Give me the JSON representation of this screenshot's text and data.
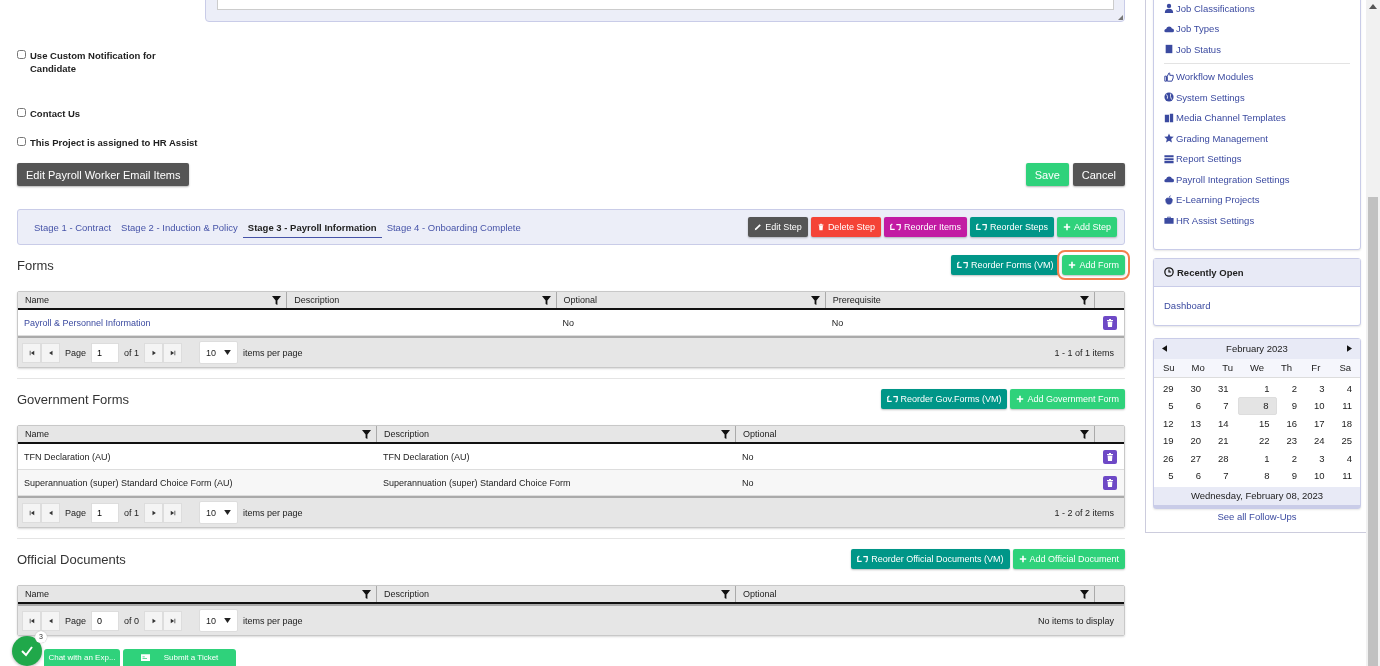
{
  "options": [
    {
      "label": "Use Custom Notification for Candidate",
      "checked": false
    },
    {
      "label": "Contact Us",
      "checked": false
    },
    {
      "label": "This Project is assigned to HR Assist",
      "checked": false
    }
  ],
  "edit_button": "Edit Payroll Worker Email Items",
  "actions": [
    {
      "label": "Save",
      "kind": "save"
    },
    {
      "label": "Cancel",
      "kind": "cancel"
    }
  ],
  "stage_tabs": [
    {
      "label": "Stage 1 - Contract",
      "selected": false
    },
    {
      "label": "Stage 2 - Induction & Policy",
      "selected": false
    },
    {
      "label": "Stage 3 - Payroll Information",
      "selected": true
    },
    {
      "label": "Stage 4 - Onboarding Complete",
      "selected": false
    }
  ],
  "step_buttons": [
    {
      "label": "Edit Step",
      "kind": "edit"
    },
    {
      "label": "Delete Step",
      "kind": "delete"
    },
    {
      "label": "Reorder Items",
      "kind": "reorder_items"
    },
    {
      "label": "Reorder Steps",
      "kind": "reorder"
    },
    {
      "label": "Add Step",
      "kind": "add"
    }
  ],
  "sections": [
    {
      "title": "Forms",
      "buttons": [
        {
          "label": "Reorder Forms (VM)",
          "kind": "reorder",
          "focused": false
        },
        {
          "label": "Add Form",
          "kind": "add",
          "focused": true
        }
      ],
      "table": {
        "columns": [
          "Name",
          "Description",
          "Optional",
          "Prerequisite"
        ],
        "rows": [
          {
            "link": true,
            "cells": [
              "Payroll & Personnel Information",
              null,
              "No",
              "No"
            ]
          }
        ],
        "pager": {
          "page_label": "Page",
          "page": "1",
          "of": "of 1",
          "page_size": "10",
          "per_page": "items per page",
          "info": "1 - 1 of 1 items"
        }
      }
    },
    {
      "title": "Government Forms",
      "buttons": [
        {
          "label": "Reorder Gov.Forms (VM)",
          "kind": "reorder",
          "focused": false
        },
        {
          "label": "Add Government Form",
          "kind": "add",
          "focused": false
        }
      ],
      "table": {
        "columns": [
          "Name",
          "Description",
          "Optional"
        ],
        "rows": [
          {
            "link": false,
            "cells": [
              "TFN Declaration (AU)",
              "TFN Declaration (AU)",
              "No"
            ]
          },
          {
            "link": false,
            "cells": [
              "Superannuation (super) Standard Choice Form (AU)",
              "Superannuation (super) Standard Choice Form",
              "No"
            ]
          }
        ],
        "pager": {
          "page_label": "Page",
          "page": "1",
          "of": "of 1",
          "page_size": "10",
          "per_page": "items per page",
          "info": "1 - 2 of 2 items"
        }
      }
    },
    {
      "title": "Official Documents",
      "buttons": [
        {
          "label": "Reorder Official Documents (VM)",
          "kind": "reorder",
          "focused": false
        },
        {
          "label": "Add Official Document",
          "kind": "add",
          "focused": false
        }
      ],
      "table": {
        "columns": [
          "Name",
          "Description",
          "Optional"
        ],
        "pager": {
          "page_label": "Page",
          "page": "0",
          "of": "of 0",
          "page_size": "10",
          "per_page": "items per page",
          "info": "No items to display"
        }
      }
    }
  ],
  "menu": [
    [
      {
        "label": "Job Classifications",
        "kind": "person"
      },
      {
        "label": "Job Types",
        "kind": "cloud"
      },
      {
        "label": "Job Status",
        "kind": "book"
      }
    ],
    [
      {
        "label": "Workflow Modules",
        "kind": "thumb"
      },
      {
        "label": "System Settings",
        "kind": "globe"
      },
      {
        "label": "Media Channel Templates",
        "kind": "files"
      },
      {
        "label": "Grading Management",
        "kind": "star"
      },
      {
        "label": "Report Settings",
        "kind": "report"
      },
      {
        "label": "Payroll Integration Settings",
        "kind": "cloud"
      },
      {
        "label": "E-Learning Projects",
        "kind": "apple"
      },
      {
        "label": "HR Assist Settings",
        "kind": "briefcase"
      }
    ]
  ],
  "recently_open": {
    "title": "Recently Open",
    "items": [
      "Dashboard"
    ]
  },
  "calendar": {
    "month": "February 2023",
    "weekdays": [
      "Su",
      "Mo",
      "Tu",
      "We",
      "Th",
      "Fr",
      "Sa"
    ],
    "weeks": [
      [
        {
          "day": "29",
          "selected": false
        },
        {
          "day": "30",
          "selected": false
        },
        {
          "day": "31",
          "selected": false
        },
        {
          "day": "1",
          "selected": false
        },
        {
          "day": "2",
          "selected": false
        },
        {
          "day": "3",
          "selected": false
        },
        {
          "day": "4",
          "selected": false
        }
      ],
      [
        {
          "day": "5",
          "selected": false
        },
        {
          "day": "6",
          "selected": false
        },
        {
          "day": "7",
          "selected": false
        },
        {
          "day": "8",
          "selected": true
        },
        {
          "day": "9",
          "selected": false
        },
        {
          "day": "10",
          "selected": false
        },
        {
          "day": "11",
          "selected": false
        }
      ],
      [
        {
          "day": "12",
          "selected": false
        },
        {
          "day": "13",
          "selected": false
        },
        {
          "day": "14",
          "selected": false
        },
        {
          "day": "15",
          "selected": false
        },
        {
          "day": "16",
          "selected": false
        },
        {
          "day": "17",
          "selected": false
        },
        {
          "day": "18",
          "selected": false
        }
      ],
      [
        {
          "day": "19",
          "selected": false
        },
        {
          "day": "20",
          "selected": false
        },
        {
          "day": "21",
          "selected": false
        },
        {
          "day": "22",
          "selected": false
        },
        {
          "day": "23",
          "selected": false
        },
        {
          "day": "24",
          "selected": false
        },
        {
          "day": "25",
          "selected": false
        }
      ],
      [
        {
          "day": "26",
          "selected": false
        },
        {
          "day": "27",
          "selected": false
        },
        {
          "day": "28",
          "selected": false
        },
        {
          "day": "1",
          "selected": false
        },
        {
          "day": "2",
          "selected": false
        },
        {
          "day": "3",
          "selected": false
        },
        {
          "day": "4",
          "selected": false
        }
      ],
      [
        {
          "day": "5",
          "selected": false
        },
        {
          "day": "6",
          "selected": false
        },
        {
          "day": "7",
          "selected": false
        },
        {
          "day": "8",
          "selected": false
        },
        {
          "day": "9",
          "selected": false
        },
        {
          "day": "10",
          "selected": false
        },
        {
          "day": "11",
          "selected": false
        }
      ]
    ],
    "footer": "Wednesday, February 08, 2023"
  },
  "follow_ups_link": "See all Follow-Ups",
  "chat": {
    "badge": "3",
    "chat_button": "Chat with an Exp...",
    "ticket_button": "Submit a Ticket"
  }
}
